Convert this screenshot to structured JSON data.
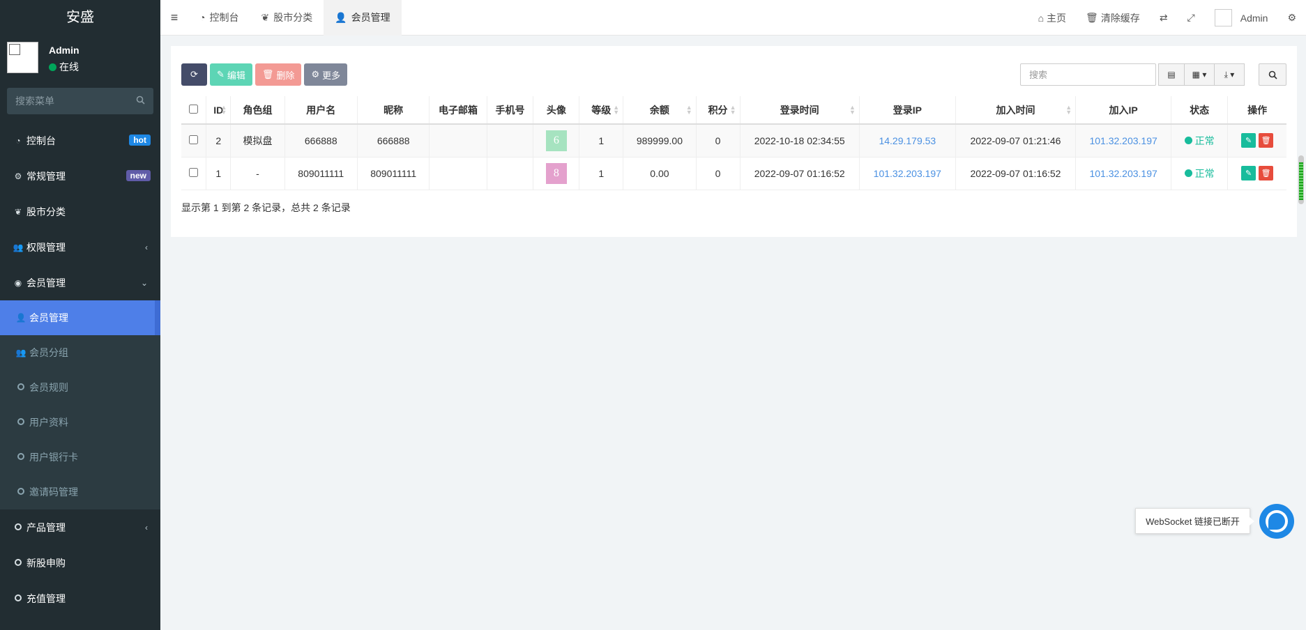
{
  "sidebar": {
    "logo": "安盛",
    "user": {
      "name": "Admin",
      "status": "在线"
    },
    "search_placeholder": "搜索菜单",
    "menu": [
      {
        "label": "控制台",
        "badge": "hot"
      },
      {
        "label": "常规管理",
        "badge": "new"
      },
      {
        "label": "股市分类"
      },
      {
        "label": "权限管理"
      },
      {
        "label": "会员管理"
      }
    ],
    "submenu": [
      {
        "label": "会员管理"
      },
      {
        "label": "会员分组"
      },
      {
        "label": "会员规则"
      },
      {
        "label": "用户资料"
      },
      {
        "label": "用户银行卡"
      },
      {
        "label": "邀请码管理"
      }
    ],
    "menu_bottom": [
      {
        "label": "产品管理"
      },
      {
        "label": "新股申购"
      },
      {
        "label": "充值管理"
      }
    ]
  },
  "header": {
    "tabs": [
      "控制台",
      "股市分类",
      "会员管理"
    ],
    "home": "主页",
    "clear_cache": "清除缓存",
    "admin": "Admin"
  },
  "toolbar": {
    "edit": "编辑",
    "delete": "删除",
    "more": "更多",
    "search_placeholder": "搜索"
  },
  "table": {
    "columns": [
      "ID",
      "角色组",
      "用户名",
      "昵称",
      "电子邮箱",
      "手机号",
      "头像",
      "等级",
      "余额",
      "积分",
      "登录时间",
      "登录IP",
      "加入时间",
      "加入IP",
      "状态",
      "操作"
    ],
    "rows": [
      {
        "id": "2",
        "group": "模拟盘",
        "username": "666888",
        "nickname": "666888",
        "email": "",
        "mobile": "",
        "avatar": "6",
        "avatar_color": "#a6e3c0",
        "level": "1",
        "balance": "989999.00",
        "score": "0",
        "logintime": "2022-10-18 02:34:55",
        "loginip": "14.29.179.53",
        "jointime": "2022-09-07 01:21:46",
        "joinip": "101.32.203.197",
        "status": "正常"
      },
      {
        "id": "1",
        "group": "-",
        "username": "809011111",
        "nickname": "809011111",
        "email": "",
        "mobile": "",
        "avatar": "8",
        "avatar_color": "#e4a1cd",
        "level": "1",
        "balance": "0.00",
        "score": "0",
        "logintime": "2022-09-07 01:16:52",
        "loginip": "101.32.203.197",
        "jointime": "2022-09-07 01:16:52",
        "joinip": "101.32.203.197",
        "status": "正常"
      }
    ],
    "pager_info": "显示第 1 到第 2 条记录，总共 2 条记录"
  },
  "websocket": {
    "tip": "WebSocket 链接已断开"
  },
  "colors": {
    "accent": "#4e7fe8",
    "success": "#18bc9c",
    "danger": "#e74c3c",
    "sidebar_bg": "#222d32"
  }
}
